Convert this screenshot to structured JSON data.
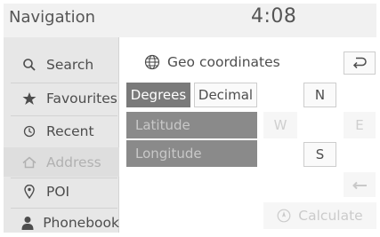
{
  "header": {
    "title": "Navigation",
    "clock": "4:08"
  },
  "sidebar": {
    "items": [
      {
        "label": "Search",
        "icon": "search-icon",
        "state": "normal"
      },
      {
        "label": "Favourites",
        "icon": "star-icon",
        "state": "normal"
      },
      {
        "label": "Recent",
        "icon": "clock-icon",
        "state": "normal"
      },
      {
        "label": "Address",
        "icon": "house-icon",
        "state": "selected-dimmed"
      },
      {
        "label": "POI",
        "icon": "pin-icon",
        "state": "normal"
      },
      {
        "label": "Phonebook",
        "icon": "person-icon",
        "state": "normal"
      }
    ]
  },
  "main": {
    "heading": "Geo coordinates",
    "heading_icon": "globe-icon",
    "format_toggle": {
      "degrees": "Degrees",
      "decimal": "Decimal",
      "selected": "Degrees"
    },
    "latitude_placeholder": "Latitude",
    "longitude_placeholder": "Longitude",
    "compass": {
      "north": "N",
      "west": "W",
      "east": "E",
      "south": "S"
    },
    "calculate_label": "Calculate"
  },
  "colors": {
    "selected_toggle": "#7a7a7a",
    "input_field": "#8a8a8a",
    "sidebar_bg": "#e7e7e7",
    "disabled_text": "#cbcbcb"
  }
}
